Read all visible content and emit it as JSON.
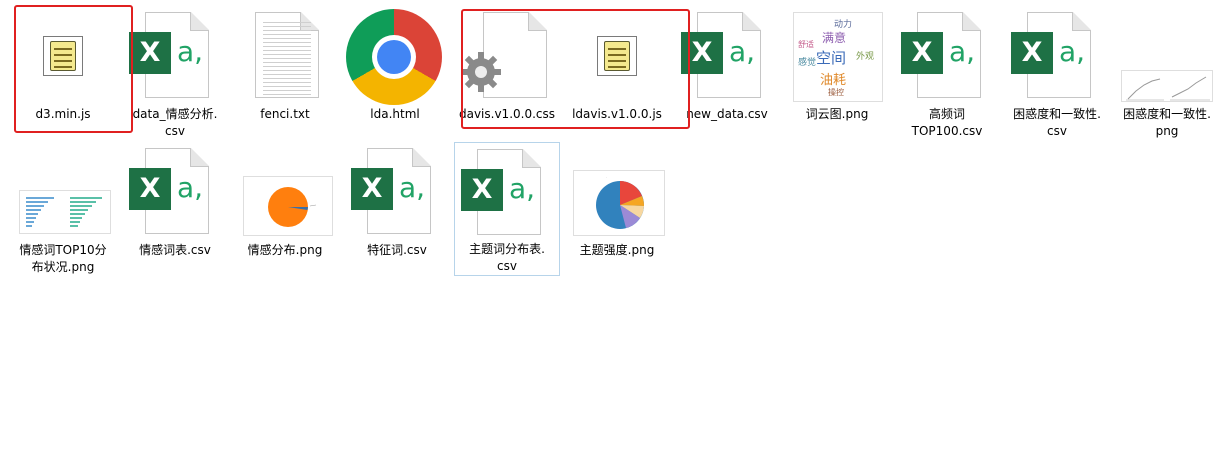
{
  "files": [
    {
      "name": "d3.min.js",
      "type": "js"
    },
    {
      "name": "data_情感分析.\ncsv",
      "type": "excel"
    },
    {
      "name": "fenci.txt",
      "type": "txt"
    },
    {
      "name": "lda.html",
      "type": "chrome"
    },
    {
      "name": "davis.v1.0.0.css",
      "type": "css"
    },
    {
      "name": "ldavis.v1.0.0.js",
      "type": "js"
    },
    {
      "name": "new_data.csv",
      "type": "excel"
    },
    {
      "name": "词云图.png",
      "type": "wordcloud-image"
    },
    {
      "name": "高频词\nTOP100.csv",
      "type": "excel"
    },
    {
      "name": "困惑度和一致性.\ncsv",
      "type": "excel"
    },
    {
      "name": "困惑度和一致性.\npng",
      "type": "line-chart-image"
    },
    {
      "name": "情感词TOP10分\n布状况.png",
      "type": "bar-chart-image"
    },
    {
      "name": "情感词表.csv",
      "type": "excel"
    },
    {
      "name": "情感分布.png",
      "type": "pie-chart-image"
    },
    {
      "name": "特征词.csv",
      "type": "excel"
    },
    {
      "name": "主题词分布表.\ncsv",
      "type": "excel",
      "selected": true
    },
    {
      "name": "主题强度.png",
      "type": "pie-chart-image"
    }
  ],
  "excel": {
    "letter": "X",
    "suffix": "a,"
  },
  "wordcloud": {
    "words": [
      "动力",
      "满意",
      "空间",
      "油耗",
      "外观",
      "舒适",
      "感觉",
      "操控"
    ]
  },
  "colors": {
    "excel_green": "#1e7145",
    "highlight_red": "#e02020",
    "selection": "#b7d4ea"
  }
}
